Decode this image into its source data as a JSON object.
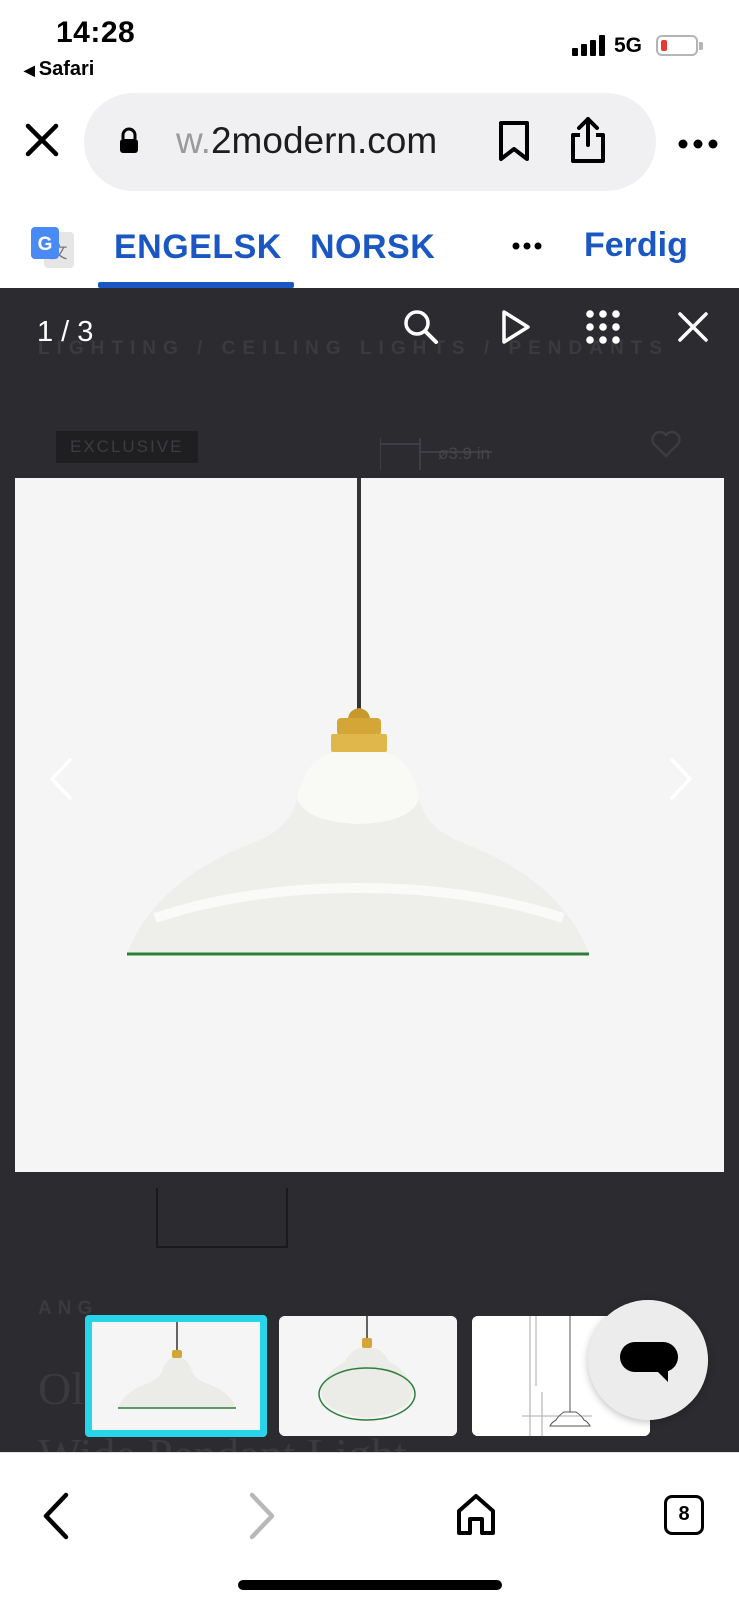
{
  "status_bar": {
    "time": "14:28",
    "back_app": "Safari",
    "network": "5G",
    "battery_level": 0.1
  },
  "browser": {
    "url_faded": "w.",
    "url_domain": "2modern.com",
    "icons": [
      "close-icon",
      "lock-icon",
      "bookmark-icon",
      "share-icon",
      "more-icon"
    ]
  },
  "translate": {
    "source_lang": "ENGELSK",
    "target_lang": "NORSK",
    "done_label": "Ferdig",
    "google_icon_letter": "G",
    "google_icon_glyph": "文"
  },
  "background_page": {
    "breadcrumb": "LIGHTING  /  CEILING LIGHTS  /  PENDANTS",
    "badge": "EXCLUSIVE",
    "dimension_label": "ø3.9 in",
    "vendor_partial": "ANG",
    "title_line1": "Ol",
    "title_line2": "Wide Pendant Light"
  },
  "gallery": {
    "counter": "1 / 3",
    "current_index": 1,
    "total": 3,
    "thumbnails": [
      "pendant-front-view",
      "pendant-underside-view",
      "pendant-dimension-drawing"
    ],
    "selected_thumbnail": 1,
    "colors": {
      "overlay": "#2c2c30",
      "selection": "#27d4ea",
      "shade_rim": "#2e7d3a",
      "brass": "#d4a637"
    }
  },
  "toolbar": {
    "tabs_count": "8"
  }
}
